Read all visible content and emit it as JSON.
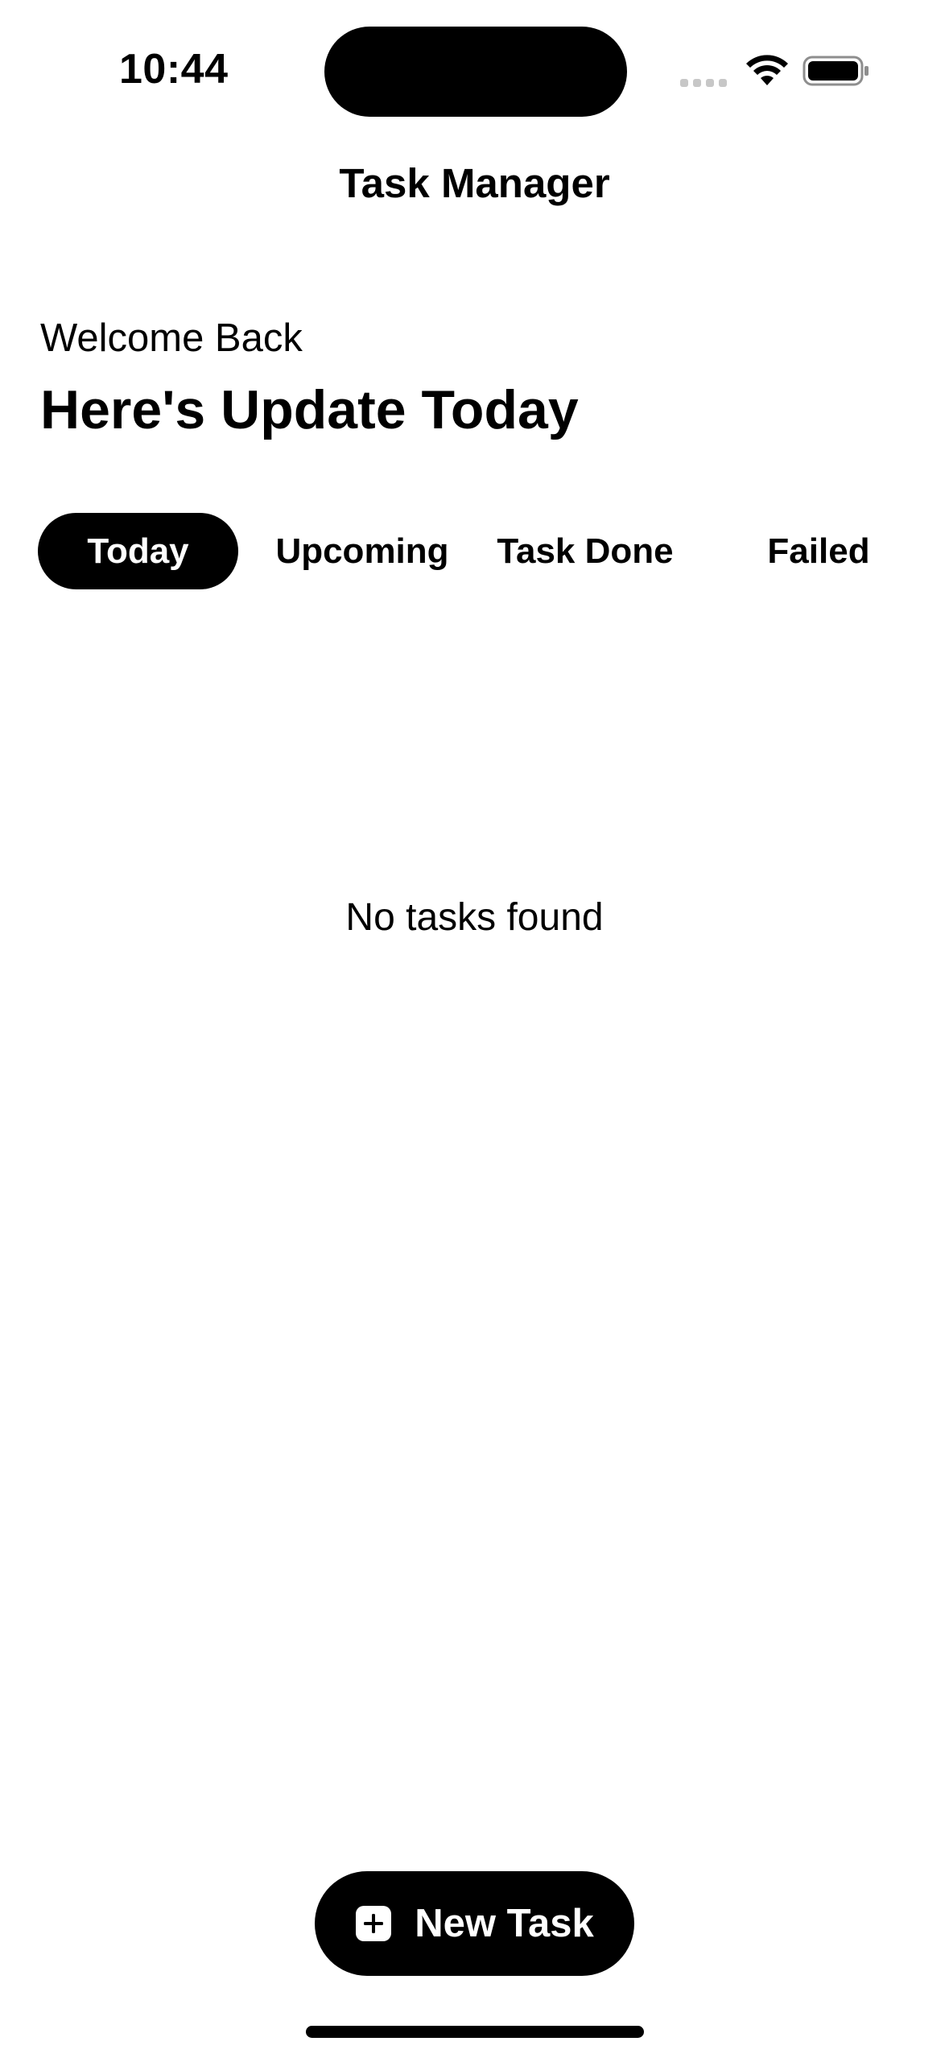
{
  "status_bar": {
    "time": "10:44",
    "icons": [
      "cellular-signal-icon",
      "wifi-icon",
      "battery-icon"
    ]
  },
  "nav": {
    "title": "Task Manager"
  },
  "greeting": {
    "welcome": "Welcome Back",
    "headline": "Here's Update Today"
  },
  "tabs": [
    {
      "label": "Today",
      "selected": true
    },
    {
      "label": "Upcoming",
      "selected": false
    },
    {
      "label": "Task Done",
      "selected": false
    },
    {
      "label": "Failed",
      "selected": false
    }
  ],
  "empty_state": {
    "message": "No tasks found"
  },
  "actions": {
    "new_task_label": "New Task",
    "new_task_icon": "plus-square-icon"
  },
  "colors": {
    "background": "#ffffff",
    "primary": "#000000",
    "on_primary": "#ffffff"
  }
}
